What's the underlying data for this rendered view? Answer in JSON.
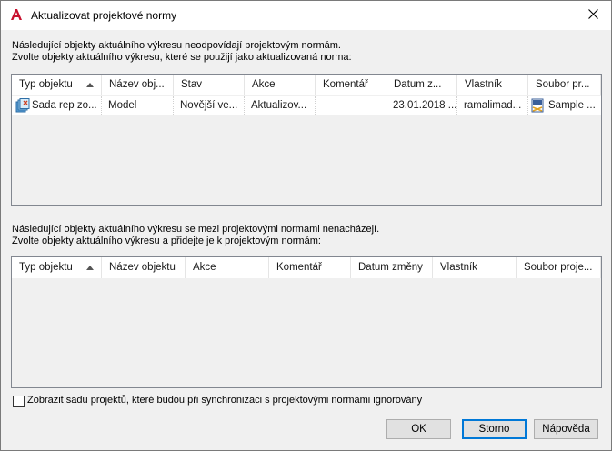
{
  "window": {
    "title": "Aktualizovat projektové normy",
    "accent_color": "#c8102e"
  },
  "section1": {
    "line1": "Následující objekty aktuálního výkresu neodpovídají projektovým normám.",
    "line2": "Zvolte objekty aktuálního výkresu, které se použijí jako aktualizovaná norma:",
    "columns": [
      "Typ objektu",
      "Název obj...",
      "Stav",
      "Akce",
      "Komentář",
      "Datum z...",
      "Vlastník",
      "Soubor pr..."
    ],
    "rows": [
      {
        "type_icon": "layer-states-icon",
        "type": "Sada rep zo...",
        "name": "Model",
        "status": "Novější ve...",
        "action": "Aktualizov...",
        "comment": "",
        "date": "23.01.2018 ...",
        "owner": "ramalimad...",
        "file_icon": "dst-file-icon",
        "file": "Sample ..."
      }
    ]
  },
  "section2": {
    "line1": "Následující objekty aktuálního výkresu se mezi projektovými normami nenacházejí.",
    "line2": "Zvolte objekty aktuálního výkresu a přidejte je k projektovým normám:",
    "columns": [
      "Typ objektu",
      "Název objektu",
      "Akce",
      "Komentář",
      "Datum změny",
      "Vlastník",
      "Soubor proje..."
    ],
    "rows": []
  },
  "ignore_checkbox": {
    "label": "Zobrazit sadu projektů, které budou při synchronizaci s projektovými normami ignorovány",
    "checked": false
  },
  "buttons": {
    "ok": "OK",
    "cancel": "Storno",
    "help": "Nápověda"
  }
}
